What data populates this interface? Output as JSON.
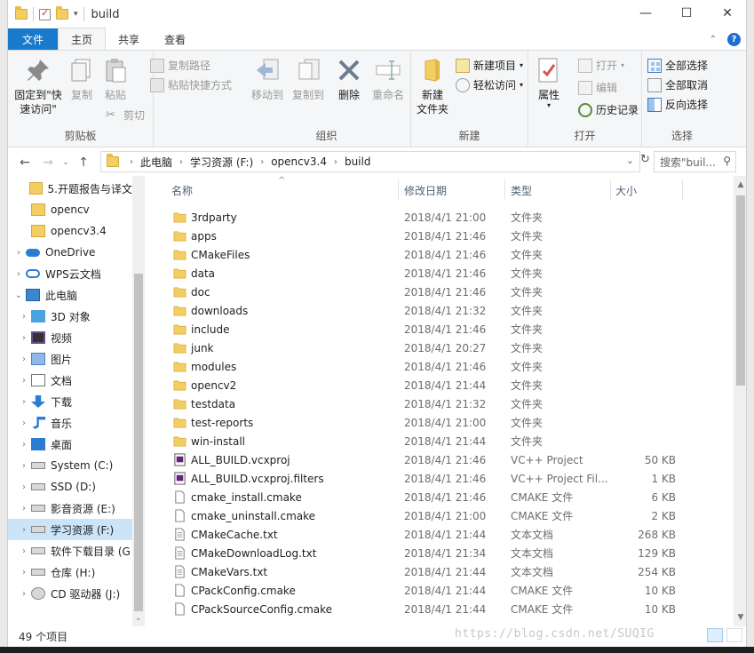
{
  "window": {
    "title": "build",
    "minimize_glyph": "—",
    "maximize_glyph": "☐",
    "close_glyph": "✕"
  },
  "ribbon_tabs": [
    {
      "label": "文件"
    },
    {
      "label": "主页"
    },
    {
      "label": "共享"
    },
    {
      "label": "查看"
    }
  ],
  "ribbon": {
    "clipboard": {
      "label": "剪贴板",
      "pin_label": "固定到\"快\n速访问\"",
      "copy_label": "复制",
      "paste_label": "粘贴",
      "copy_path_label": "复制路径",
      "paste_shortcut_label": "粘贴快捷方式",
      "cut_label": "剪切"
    },
    "organize": {
      "label": "组织",
      "move_to_label": "移动到",
      "copy_to_label": "复制到",
      "delete_label": "删除",
      "rename_label": "重命名"
    },
    "new": {
      "label": "新建",
      "new_folder_label": "新建\n文件夹",
      "new_item_label": "新建项目",
      "easy_access_label": "轻松访问"
    },
    "open": {
      "label": "打开",
      "properties_label": "属性",
      "open_label": "打开",
      "edit_label": "编辑",
      "history_label": "历史记录"
    },
    "select": {
      "label": "选择",
      "select_all_label": "全部选择",
      "select_none_label": "全部取消",
      "invert_label": "反向选择"
    }
  },
  "address": {
    "crumbs": [
      "此电脑",
      "学习资源 (F:)",
      "opencv3.4",
      "build"
    ],
    "search_placeholder": "搜索\"buil..."
  },
  "nav_pane": {
    "items": [
      {
        "label": "5.开题报告与译文",
        "icon": "folder-icon",
        "indent": 1,
        "expander": ""
      },
      {
        "label": "opencv",
        "icon": "folder-icon",
        "indent": 1,
        "expander": ""
      },
      {
        "label": "opencv3.4",
        "icon": "folder-icon",
        "indent": 1,
        "expander": ""
      },
      {
        "label": "OneDrive",
        "icon": "onedrive-icon",
        "indent": 0,
        "expander": "›"
      },
      {
        "label": "WPS云文档",
        "icon": "wps-cloud-icon",
        "indent": 0,
        "expander": "›"
      },
      {
        "label": "此电脑",
        "icon": "pc-icon",
        "indent": 0,
        "expander": "⌄"
      },
      {
        "label": "3D 对象",
        "icon": "3d-objects-icon",
        "indent": 1,
        "expander": "›"
      },
      {
        "label": "视频",
        "icon": "video-icon",
        "indent": 1,
        "expander": "›"
      },
      {
        "label": "图片",
        "icon": "pictures-icon",
        "indent": 1,
        "expander": "›"
      },
      {
        "label": "文档",
        "icon": "documents-icon",
        "indent": 1,
        "expander": "›"
      },
      {
        "label": "下载",
        "icon": "downloads-icon",
        "indent": 1,
        "expander": "›"
      },
      {
        "label": "音乐",
        "icon": "music-icon",
        "indent": 1,
        "expander": "›"
      },
      {
        "label": "桌面",
        "icon": "desktop-icon",
        "indent": 1,
        "expander": "›"
      },
      {
        "label": "System (C:)",
        "icon": "drive-icon",
        "indent": 1,
        "expander": "›"
      },
      {
        "label": "SSD (D:)",
        "icon": "drive-icon",
        "indent": 1,
        "expander": "›"
      },
      {
        "label": "影音资源 (E:)",
        "icon": "drive-icon",
        "indent": 1,
        "expander": "›"
      },
      {
        "label": "学习资源 (F:)",
        "icon": "drive-icon",
        "indent": 1,
        "expander": "›",
        "selected": true
      },
      {
        "label": "软件下载目录 (G",
        "icon": "drive-icon",
        "indent": 1,
        "expander": "›"
      },
      {
        "label": "仓库 (H:)",
        "icon": "drive-icon",
        "indent": 1,
        "expander": "›"
      },
      {
        "label": "CD 驱动器 (J:)",
        "icon": "cd-drive-icon",
        "indent": 1,
        "expander": "›"
      }
    ]
  },
  "columns": {
    "name": "名称",
    "date": "修改日期",
    "type": "类型",
    "size": "大小"
  },
  "files": [
    {
      "name": "3rdparty",
      "date": "2018/4/1 21:00",
      "type": "文件夹",
      "size": "",
      "icon": "folder-icon"
    },
    {
      "name": "apps",
      "date": "2018/4/1 21:46",
      "type": "文件夹",
      "size": "",
      "icon": "folder-icon"
    },
    {
      "name": "CMakeFiles",
      "date": "2018/4/1 21:46",
      "type": "文件夹",
      "size": "",
      "icon": "folder-icon"
    },
    {
      "name": "data",
      "date": "2018/4/1 21:46",
      "type": "文件夹",
      "size": "",
      "icon": "folder-icon"
    },
    {
      "name": "doc",
      "date": "2018/4/1 21:46",
      "type": "文件夹",
      "size": "",
      "icon": "folder-icon"
    },
    {
      "name": "downloads",
      "date": "2018/4/1 21:32",
      "type": "文件夹",
      "size": "",
      "icon": "folder-icon"
    },
    {
      "name": "include",
      "date": "2018/4/1 21:46",
      "type": "文件夹",
      "size": "",
      "icon": "folder-icon"
    },
    {
      "name": "junk",
      "date": "2018/4/1 20:27",
      "type": "文件夹",
      "size": "",
      "icon": "folder-icon"
    },
    {
      "name": "modules",
      "date": "2018/4/1 21:46",
      "type": "文件夹",
      "size": "",
      "icon": "folder-icon"
    },
    {
      "name": "opencv2",
      "date": "2018/4/1 21:44",
      "type": "文件夹",
      "size": "",
      "icon": "folder-icon"
    },
    {
      "name": "testdata",
      "date": "2018/4/1 21:32",
      "type": "文件夹",
      "size": "",
      "icon": "folder-icon"
    },
    {
      "name": "test-reports",
      "date": "2018/4/1 21:00",
      "type": "文件夹",
      "size": "",
      "icon": "folder-icon"
    },
    {
      "name": "win-install",
      "date": "2018/4/1 21:44",
      "type": "文件夹",
      "size": "",
      "icon": "folder-icon"
    },
    {
      "name": "ALL_BUILD.vcxproj",
      "date": "2018/4/1 21:46",
      "type": "VC++ Project",
      "size": "50 KB",
      "icon": "vcxproj-icon"
    },
    {
      "name": "ALL_BUILD.vcxproj.filters",
      "date": "2018/4/1 21:46",
      "type": "VC++ Project Fil...",
      "size": "1 KB",
      "icon": "vcxproj-filters-icon"
    },
    {
      "name": "cmake_install.cmake",
      "date": "2018/4/1 21:46",
      "type": "CMAKE 文件",
      "size": "6 KB",
      "icon": "file-icon"
    },
    {
      "name": "cmake_uninstall.cmake",
      "date": "2018/4/1 21:00",
      "type": "CMAKE 文件",
      "size": "2 KB",
      "icon": "file-icon"
    },
    {
      "name": "CMakeCache.txt",
      "date": "2018/4/1 21:44",
      "type": "文本文档",
      "size": "268 KB",
      "icon": "text-file-icon"
    },
    {
      "name": "CMakeDownloadLog.txt",
      "date": "2018/4/1 21:34",
      "type": "文本文档",
      "size": "129 KB",
      "icon": "text-file-icon"
    },
    {
      "name": "CMakeVars.txt",
      "date": "2018/4/1 21:44",
      "type": "文本文档",
      "size": "254 KB",
      "icon": "text-file-icon"
    },
    {
      "name": "CPackConfig.cmake",
      "date": "2018/4/1 21:44",
      "type": "CMAKE 文件",
      "size": "10 KB",
      "icon": "file-icon"
    },
    {
      "name": "CPackSourceConfig.cmake",
      "date": "2018/4/1 21:44",
      "type": "CMAKE 文件",
      "size": "10 KB",
      "icon": "file-icon"
    }
  ],
  "status": {
    "item_count": "49 个项目"
  },
  "watermark": "https://blog.csdn.net/SUQIG",
  "colors": {
    "accent": "#1979ca",
    "folder": "#f3cf63",
    "selection": "#cce4f7"
  }
}
